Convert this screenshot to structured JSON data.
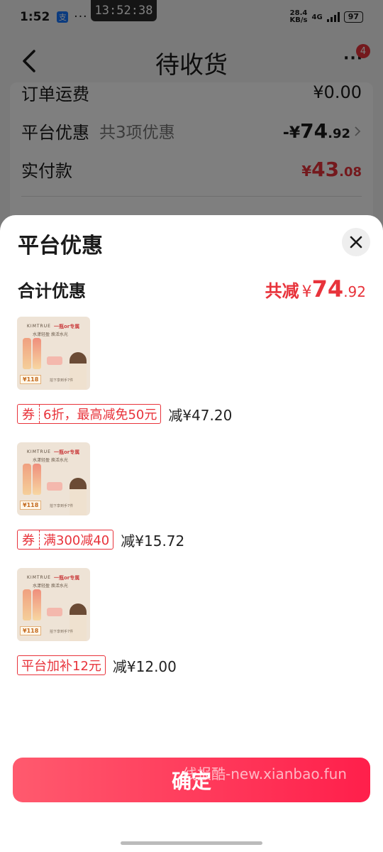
{
  "status_bar": {
    "time": "1:52",
    "app_icon_glyph": "支",
    "dots": "···",
    "net_speed_top": "28.4",
    "net_speed_bottom": "KB/s",
    "net_type": "4G",
    "battery": "97"
  },
  "time_overlay": "13:52:38",
  "nav": {
    "title": "待收货",
    "more": "···",
    "badge_count": "4"
  },
  "order_summary": {
    "shipping_label": "订单运费",
    "shipping_amount": "¥0.00",
    "platform_discount_label": "平台优惠",
    "platform_discount_sub": "共3项优惠",
    "platform_discount_prefix": "-¥",
    "platform_discount_int": "74",
    "platform_discount_dec": ".92",
    "paid_label": "实付款",
    "paid_yen": "¥",
    "paid_int": "43",
    "paid_dec": ".08"
  },
  "sheet": {
    "title": "平台优惠",
    "total_label": "合计优惠",
    "total_prefix": "共减",
    "total_yen": "¥",
    "total_int": "74",
    "total_dec": ".92",
    "items": [
      {
        "thumb": {
          "brand": "KIMTRUE",
          "tag": "一瓶or专属",
          "slogan": "水漾轻盈 焕活水光",
          "price": "¥118",
          "cta": "拍下享到手7件"
        },
        "coupon_kind": "券",
        "coupon_desc": "6折，最高减免50元",
        "reduce": "减¥47.20"
      },
      {
        "thumb": {
          "brand": "KIMTRUE",
          "tag": "一瓶or专属",
          "slogan": "水漾轻盈 焕活水光",
          "price": "¥118",
          "cta": "拍下享到手7件"
        },
        "coupon_kind": "券",
        "coupon_desc": "满300减40",
        "reduce": "减¥15.72"
      },
      {
        "thumb": {
          "brand": "KIMTRUE",
          "tag": "一瓶or专属",
          "slogan": "水漾轻盈 焕活水光",
          "price": "¥118",
          "cta": "拍下享到手7件"
        },
        "coupon_desc": "平台加补12元",
        "reduce": "减¥12.00"
      }
    ],
    "confirm_label": "确定",
    "watermark": "线报酷-new.xianbao.fun"
  },
  "colors": {
    "accent_red": "#e8333b",
    "button_gradient_start": "#ff5a6e",
    "button_gradient_end": "#ff1f4b"
  }
}
